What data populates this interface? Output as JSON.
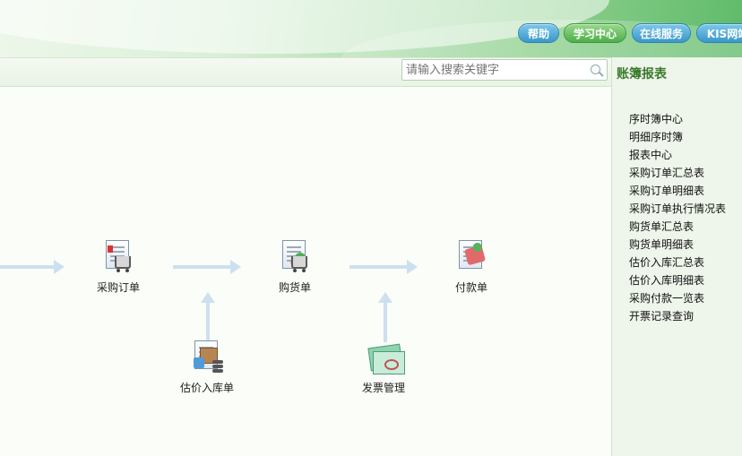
{
  "header": {
    "buttons": [
      {
        "label": "帮助",
        "color": "#3b97c9"
      },
      {
        "label": "学习中心",
        "color": "#4fae4a"
      },
      {
        "label": "在线服务",
        "color": "#3b97c9"
      },
      {
        "label": "KIS网站",
        "color": "#3b97c9"
      }
    ]
  },
  "search": {
    "placeholder": "请输入搜索关键字",
    "icon": "search-icon"
  },
  "right_panel": {
    "title": "账簿报表",
    "items": [
      "序时簿中心",
      "明细序时簿",
      "报表中心",
      "采购订单汇总表",
      "采购订单明细表",
      "采购订单执行情况表",
      "购货单汇总表",
      "购货单明细表",
      "估价入库汇总表",
      "估价入库明细表",
      "采购付款一览表",
      "开票记录查询"
    ]
  },
  "flow": {
    "nodes": [
      {
        "label": "采购订单",
        "icon": "purchase-order-icon"
      },
      {
        "label": "购货单",
        "icon": "purchase-receipt-icon"
      },
      {
        "label": "付款单",
        "icon": "payment-icon"
      },
      {
        "label": "估价入库单",
        "icon": "estimated-stock-in-icon"
      },
      {
        "label": "发票管理",
        "icon": "invoice-icon"
      }
    ]
  }
}
